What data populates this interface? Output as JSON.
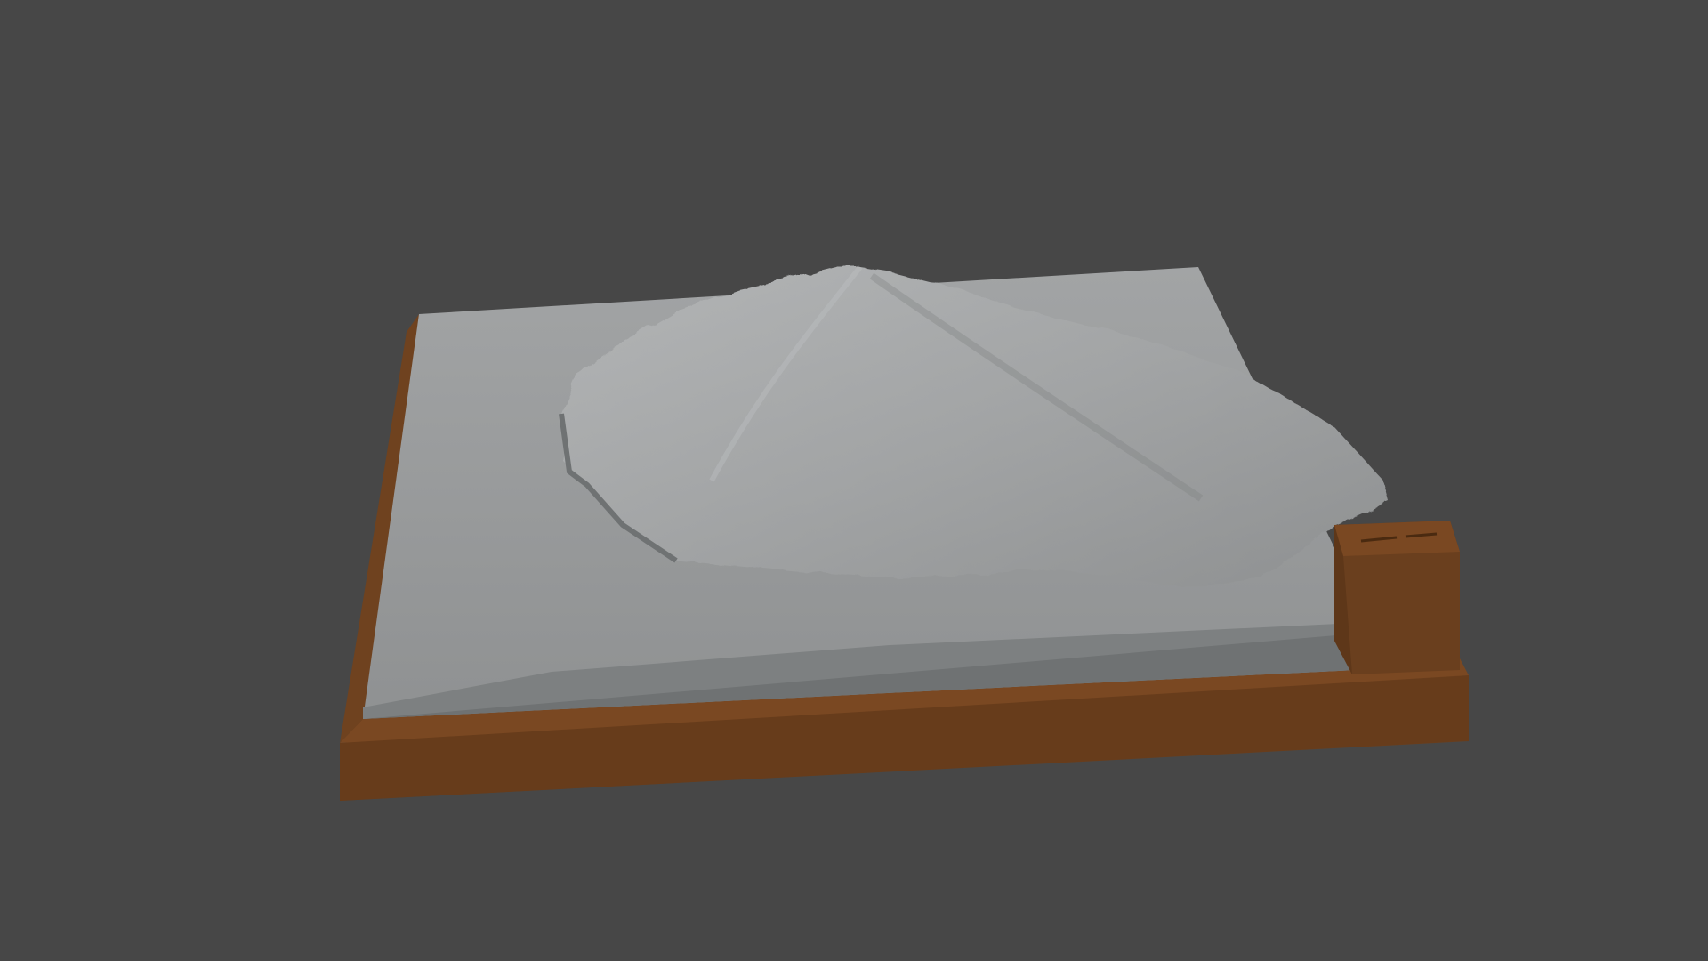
{
  "scene": {
    "subject": "terrain-model",
    "colors": {
      "background": "#474747",
      "base": "#6a3f1e",
      "base_top": "#7a4822",
      "terrain_top": "#9a9c9d",
      "terrain_side": "#6b6e6f",
      "mountain": "#a7a9aa"
    }
  }
}
